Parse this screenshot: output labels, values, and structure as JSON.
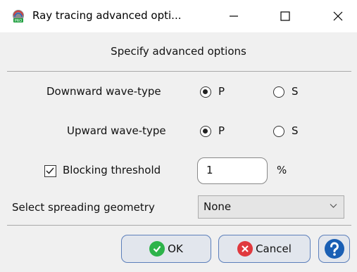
{
  "window": {
    "title": "Ray tracing advanced opti...",
    "app_icon": "ray-tracing-pro-icon",
    "controls": [
      "minimize-icon",
      "maximize-icon",
      "close-icon"
    ]
  },
  "heading": "Specify advanced options",
  "downward": {
    "label": "Downward wave-type",
    "options": [
      "P",
      "S"
    ],
    "selected": "P"
  },
  "upward": {
    "label": "Upward wave-type",
    "options": [
      "P",
      "S"
    ],
    "selected": "P"
  },
  "blocking": {
    "label": "Blocking threshold",
    "checked": true,
    "value": "1",
    "unit": "%"
  },
  "spreading": {
    "label": "Select spreading geometry",
    "selected": "None"
  },
  "buttons": {
    "ok": "OK",
    "cancel": "Cancel",
    "help_icon": "help-icon"
  },
  "colors": {
    "ok_icon": "#2db34a",
    "cancel_icon": "#e0393e",
    "help_icon": "#1a5fb4",
    "button_border": "#5c7fbb"
  }
}
